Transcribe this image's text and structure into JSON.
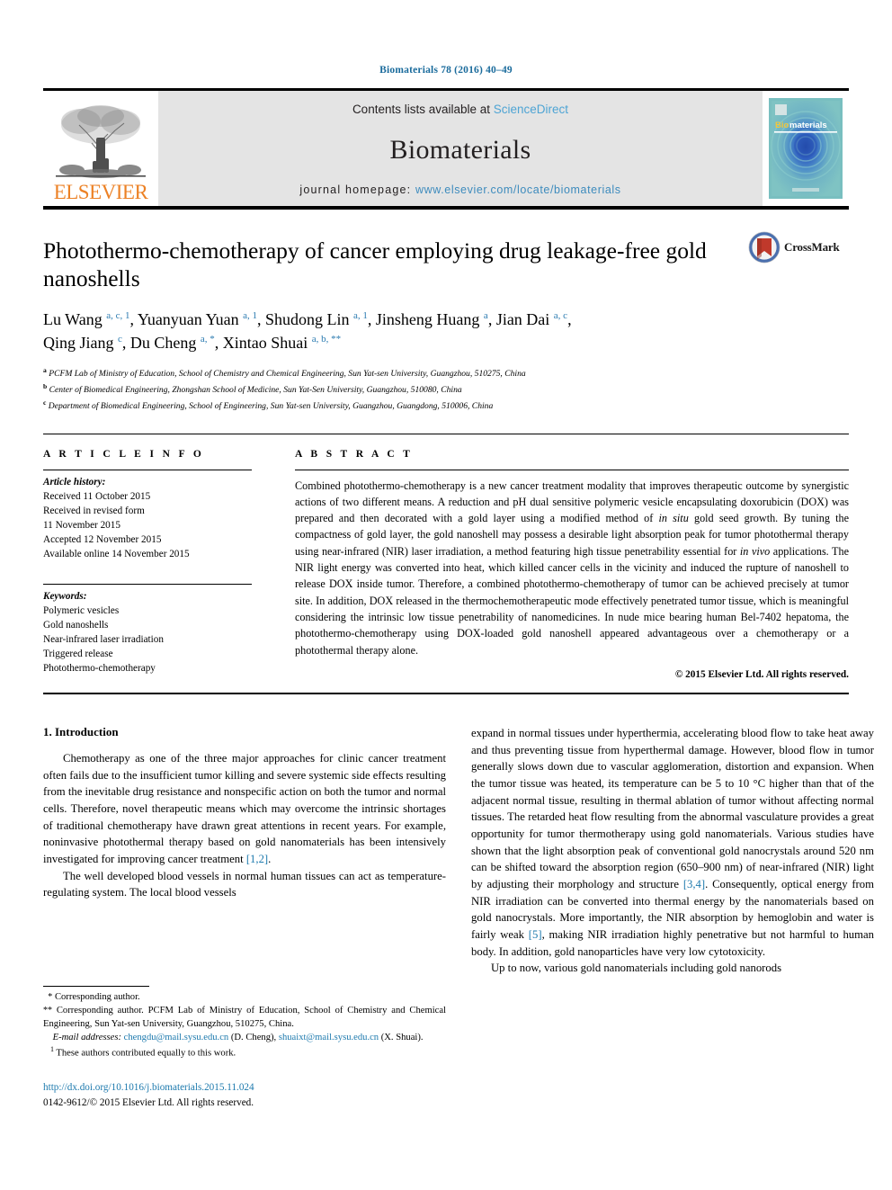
{
  "running_head": "Biomaterials 78 (2016) 40–49",
  "masthead": {
    "publisher_logo_text": "ELSEVIER",
    "contents_prefix": "Contents lists available at ",
    "contents_link": "ScienceDirect",
    "journal_name": "Biomaterials",
    "homepage_label": "journal homepage: ",
    "homepage_url": "www.elsevier.com/locate/biomaterials",
    "cover_title_bio": "Bio",
    "cover_title_materials": "materials"
  },
  "article": {
    "title": "Photothermo-chemotherapy of cancer employing drug leakage-free gold nanoshells",
    "crossmark_label": "CrossMark",
    "authors_line_1": "Lu Wang a, c, 1, Yuanyuan Yuan a, 1, Shudong Lin a, 1, Jinsheng Huang a, Jian Dai a, c,",
    "authors_line_2": "Qing Jiang c, Du Cheng a, *, Xintao Shuai a, b, **",
    "authors": [
      {
        "name": "Lu Wang",
        "marks": "a, c, 1"
      },
      {
        "name": "Yuanyuan Yuan",
        "marks": "a, 1"
      },
      {
        "name": "Shudong Lin",
        "marks": "a, 1"
      },
      {
        "name": "Jinsheng Huang",
        "marks": "a"
      },
      {
        "name": "Jian Dai",
        "marks": "a, c"
      },
      {
        "name": "Qing Jiang",
        "marks": "c"
      },
      {
        "name": "Du Cheng",
        "marks": "a, *"
      },
      {
        "name": "Xintao Shuai",
        "marks": "a, b, **"
      }
    ],
    "affiliations": [
      {
        "mark": "a",
        "text": "PCFM Lab of Ministry of Education, School of Chemistry and Chemical Engineering, Sun Yat-sen University, Guangzhou, 510275, China"
      },
      {
        "mark": "b",
        "text": "Center of Biomedical Engineering, Zhongshan School of Medicine, Sun Yat-Sen University, Guangzhou, 510080, China"
      },
      {
        "mark": "c",
        "text": "Department of Biomedical Engineering, School of Engineering, Sun Yat-sen University, Guangzhou, Guangdong, 510006, China"
      }
    ]
  },
  "article_info": {
    "heading": "A R T I C L E  I N F O",
    "history_label": "Article history:",
    "history": [
      "Received 11 October 2015",
      "Received in revised form",
      "11 November 2015",
      "Accepted 12 November 2015",
      "Available online 14 November 2015"
    ],
    "keywords_label": "Keywords:",
    "keywords": [
      "Polymeric vesicles",
      "Gold nanoshells",
      "Near-infrared laser irradiation",
      "Triggered release",
      "Photothermo-chemotherapy"
    ]
  },
  "abstract": {
    "heading": "A B S T R A C T",
    "text_part_1": "Combined photothermo-chemotherapy is a new cancer treatment modality that improves therapeutic outcome by synergistic actions of two different means. A reduction and pH dual sensitive polymeric vesicle encapsulating doxorubicin (DOX) was prepared and then decorated with a gold layer using a modified method of ",
    "italic_1": "in situ",
    "text_part_2": " gold seed growth. By tuning the compactness of gold layer, the gold nanoshell may possess a desirable light absorption peak for tumor photothermal therapy using near-infrared (NIR) laser irradiation, a method featuring high tissue penetrability essential for ",
    "italic_2": "in vivo",
    "text_part_3": " applications. The NIR light energy was converted into heat, which killed cancer cells in the vicinity and induced the rupture of nanoshell to release DOX inside tumor. Therefore, a combined photothermo-chemotherapy of tumor can be achieved precisely at tumor site. In addition, DOX released in the thermochemotherapeutic mode effectively penetrated tumor tissue, which is meaningful considering the intrinsic low tissue penetrability of nanomedicines. In nude mice bearing human Bel-7402 hepatoma, the photothermo-chemotherapy using DOX-loaded gold nanoshell appeared advantageous over a chemotherapy or a photothermal therapy alone.",
    "copyright": "© 2015 Elsevier Ltd. All rights reserved."
  },
  "introduction": {
    "heading": "1. Introduction",
    "left_paragraph_1_a": "Chemotherapy as one of the three major approaches for clinic cancer treatment often fails due to the insufficient tumor killing and severe systemic side effects resulting from the inevitable drug resistance and nonspecific action on both the tumor and normal cells. Therefore, novel therapeutic means which may overcome the intrinsic shortages of traditional chemotherapy have drawn great attentions in recent years. For example, noninvasive photothermal therapy based on gold nanomaterials has been intensively investigated for improving cancer treatment ",
    "left_paragraph_1_ref": "[1,2]",
    "left_paragraph_1_b": ".",
    "left_paragraph_2": "The well developed blood vessels in normal human tissues can act as temperature-regulating system. The local blood vessels",
    "right_paragraph_1_a": "expand in normal tissues under hyperthermia, accelerating blood flow to take heat away and thus preventing tissue from hyperthermal damage. However, blood flow in tumor generally slows down due to vascular agglomeration, distortion and expansion. When the tumor tissue was heated, its temperature can be 5 to 10 °C higher than that of the adjacent normal tissue, resulting in thermal ablation of tumor without affecting normal tissues. The retarded heat flow resulting from the abnormal vasculature provides a great opportunity for tumor thermotherapy using gold nanomaterials. Various studies have shown that the light absorption peak of conventional gold nanocrystals around 520 nm can be shifted toward the absorption region (650–900 nm) of near-infrared (NIR) light by adjusting their morphology and structure ",
    "right_paragraph_1_ref_a": "[3,4]",
    "right_paragraph_1_b": ". Consequently, optical energy from NIR irradiation can be converted into thermal energy by the nanomaterials based on gold nanocrystals. More importantly, the NIR absorption by hemoglobin and water is fairly weak ",
    "right_paragraph_1_ref_b": "[5]",
    "right_paragraph_1_c": ", making NIR irradiation highly penetrative but not harmful to human body. In addition, gold nanoparticles have very low cytotoxicity.",
    "right_paragraph_2": "Up to now, various gold nanomaterials including gold nanorods"
  },
  "footnotes": {
    "line_1_mark": "*",
    "line_1": " Corresponding author.",
    "line_2_mark": "**",
    "line_2": " Corresponding author. PCFM Lab of Ministry of Education, School of Chemistry and Chemical Engineering, Sun Yat-sen University, Guangzhou, 510275, China.",
    "email_label": "E-mail addresses:",
    "email_1": "chengdu@mail.sysu.edu.cn",
    "email_1_owner": " (D. Cheng), ",
    "email_2": "shuaixt@mail.sysu.edu.cn",
    "email_2_owner": " (X. Shuai).",
    "equal_contrib_mark": "1",
    "equal_contrib": " These authors contributed equally to this work.",
    "doi": "http://dx.doi.org/10.1016/j.biomaterials.2015.11.024",
    "issn_line": "0142-9612/© 2015 Elsevier Ltd. All rights reserved."
  },
  "colors": {
    "link": "#1c79ad",
    "elsevier_orange": "#ec8125",
    "sciencedirect": "#4ea4d4",
    "running_head": "#1a6b9c"
  }
}
